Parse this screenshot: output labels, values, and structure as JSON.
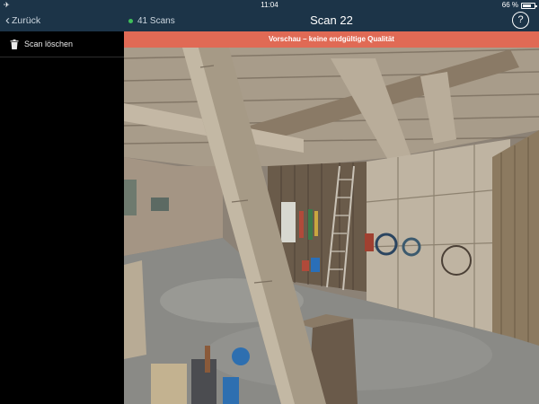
{
  "status_bar": {
    "time": "11:04",
    "battery": "66 %",
    "battery_level": 0.66,
    "airplane_icon": "airplane-icon"
  },
  "nav": {
    "back_label": "Zurück",
    "scan_count": "41 Scans",
    "title": "Scan 22",
    "help_label": "?",
    "status_color": "#3fbf5a",
    "bar_color": "#1c3448"
  },
  "sidebar": {
    "items": [
      {
        "label": "Scan löschen",
        "icon": "trash-icon"
      }
    ]
  },
  "viewer": {
    "banner": "Vorschau – keine endgültige Qualität",
    "banner_color": "#e06a55"
  }
}
